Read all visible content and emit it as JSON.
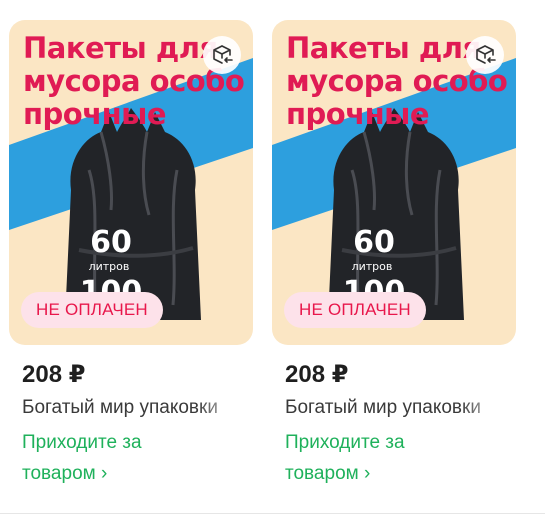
{
  "products": [
    {
      "promo_lines": [
        "Пакеты для",
        "мусора особо",
        "прочные"
      ],
      "bag_volume": "60",
      "bag_unit": "литров",
      "bag_count": "100",
      "status_badge": "НЕ ОПЛАЧЕН",
      "price": "208 ₽",
      "title": "Богатый мир упаковки",
      "pickup_line1": "Приходите за",
      "pickup_line2": "товаром ›"
    },
    {
      "promo_lines": [
        "Пакеты для",
        "мусора особо",
        "прочные"
      ],
      "bag_volume": "60",
      "bag_unit": "литров",
      "bag_count": "100",
      "status_badge": "НЕ ОПЛАЧЕН",
      "price": "208 ₽",
      "title": "Богатый мир упаковки",
      "pickup_line1": "Приходите за",
      "pickup_line2": "товаром ›"
    }
  ],
  "colors": {
    "promo_text": "#e01b54",
    "badge_bg": "#fde2ea",
    "badge_text": "#e8174b",
    "pickup_link": "#1fb15b",
    "stripe_blue": "#2d9fde",
    "image_bg": "#fbe6c4"
  },
  "icons": {
    "return": "box-return-icon"
  }
}
